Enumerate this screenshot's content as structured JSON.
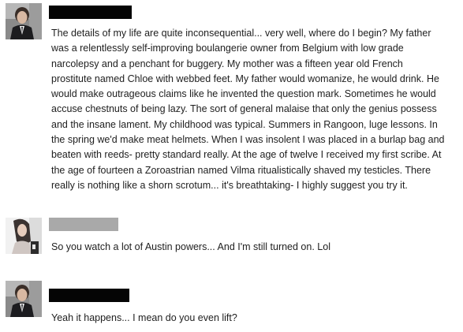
{
  "comments": [
    {
      "avatar_icon": "user-photo-dark-suit",
      "author_redacted": true,
      "text": "The details of my life are quite inconsequential... very well, where do I begin? My father was a relentlessly self-improving boulangerie owner from Belgium with low grade narcolepsy and a penchant for buggery. My mother was a fifteen year old French prostitute named Chloe with webbed feet. My father would womanize, he would drink. He would make outrageous claims like he invented the question mark. Sometimes he would accuse chestnuts of being lazy. The sort of general malaise that only the genius possess and the insane lament. My childhood was typical. Summers in Rangoon, luge lessons. In the spring we'd make meat helmets. When I was insolent I was placed in a burlap bag and beaten with reeds- pretty standard really. At the age of twelve I received my first scribe. At the age of fourteen a Zoroastrian named Vilma ritualistically shaved my testicles. There really is nothing like a shorn scrotum... it's breathtaking- I highly suggest you try it."
    },
    {
      "avatar_icon": "user-photo-light",
      "author_redacted": true,
      "text": "So you watch a lot of Austin powers... And I'm still turned on. Lol"
    },
    {
      "avatar_icon": "user-photo-dark-suit",
      "author_redacted": true,
      "text": "Yeah it happens... I mean do you even lift?"
    }
  ],
  "colors": {
    "redaction_black": "#050505",
    "redaction_gray": "#a9a9a9",
    "text": "#1e1e1e"
  }
}
